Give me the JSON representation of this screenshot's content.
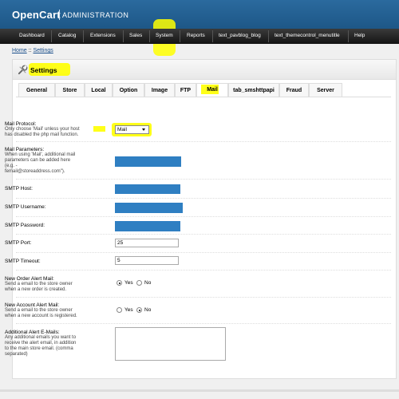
{
  "header": {
    "logo": "OpenCart",
    "subtitle": "ADMINISTRATION"
  },
  "menu": {
    "items": [
      {
        "label": "Dashboard",
        "name": "menu-item-dashboard"
      },
      {
        "label": "Catalog",
        "name": "menu-item-catalog"
      },
      {
        "label": "Extensions",
        "name": "menu-item-extensions"
      },
      {
        "label": "Sales",
        "name": "menu-item-sales"
      },
      {
        "label": "System",
        "name": "menu-item-system",
        "highlight": true
      },
      {
        "label": "Reports",
        "name": "menu-item-reports"
      },
      {
        "label": "text_pavblog_blog",
        "name": "menu-item-pavblog"
      },
      {
        "label": "text_themecontrol_menutitle",
        "name": "menu-item-themecontrol"
      },
      {
        "label": "Help",
        "name": "menu-item-help"
      }
    ],
    "active_color": "#ffff00"
  },
  "breadcrumb": {
    "home": "Home",
    "separator": "::",
    "current": "Settings"
  },
  "box": {
    "title": "Settings",
    "icon": "settings-wrench-icon"
  },
  "tabs": [
    {
      "label": "General"
    },
    {
      "label": "Store"
    },
    {
      "label": "Local"
    },
    {
      "label": "Option"
    },
    {
      "label": "Image"
    },
    {
      "label": "FTP"
    },
    {
      "label": "Mail",
      "active": true
    },
    {
      "label": "tab_smshttpapi"
    },
    {
      "label": "Fraud"
    },
    {
      "label": "Server"
    }
  ],
  "form": {
    "mail_protocol": {
      "label": "Mail Protocol:",
      "help_1": "Only choose 'Mail' unless your",
      "help_host": "host",
      "help_2": "has disabled the php mail function.",
      "value": "Mail"
    },
    "mail_parameters": {
      "label": "Mail Parameters:",
      "help_1": "When using 'Mail', additional mail",
      "help_2": "parameters can be added here",
      "help_3": "(e.g. -",
      "help_4": "femail@storeaddress.com\")."
    },
    "smtp_host": {
      "label": "SMTP Host:"
    },
    "smtp_username": {
      "label": "SMTP Username:"
    },
    "smtp_password": {
      "label": "SMTP Password:"
    },
    "smtp_port": {
      "label": "SMTP Port:",
      "value": "25"
    },
    "smtp_timeout": {
      "label": "SMTP Timeout:",
      "value": "5"
    },
    "new_order_alert": {
      "label": "New Order Alert Mail:",
      "help_1": "Send a email to the store owner",
      "help_2": "when a new order is created.",
      "yes": "Yes",
      "no": "No",
      "selected": "Yes"
    },
    "new_account_alert": {
      "label": "New Account Alert Mail:",
      "help_1": "Send a email to the store owner",
      "help_2": "when a new account is registered.",
      "yes": "Yes",
      "no": "No",
      "selected": "No"
    },
    "additional_emails": {
      "label": "Additional Alert E-Mails:",
      "help_1": "Any additional emails you want to",
      "help_2": "receive the alert email, in addition",
      "help_3": "to the main store email. (comma",
      "help_4": "separated)"
    }
  },
  "colors": {
    "header": "#1d5787",
    "menu": "#1e1e1e",
    "highlight": "#ffff00",
    "masked_field": "#2f7fc2",
    "link": "#1a4f8b"
  }
}
